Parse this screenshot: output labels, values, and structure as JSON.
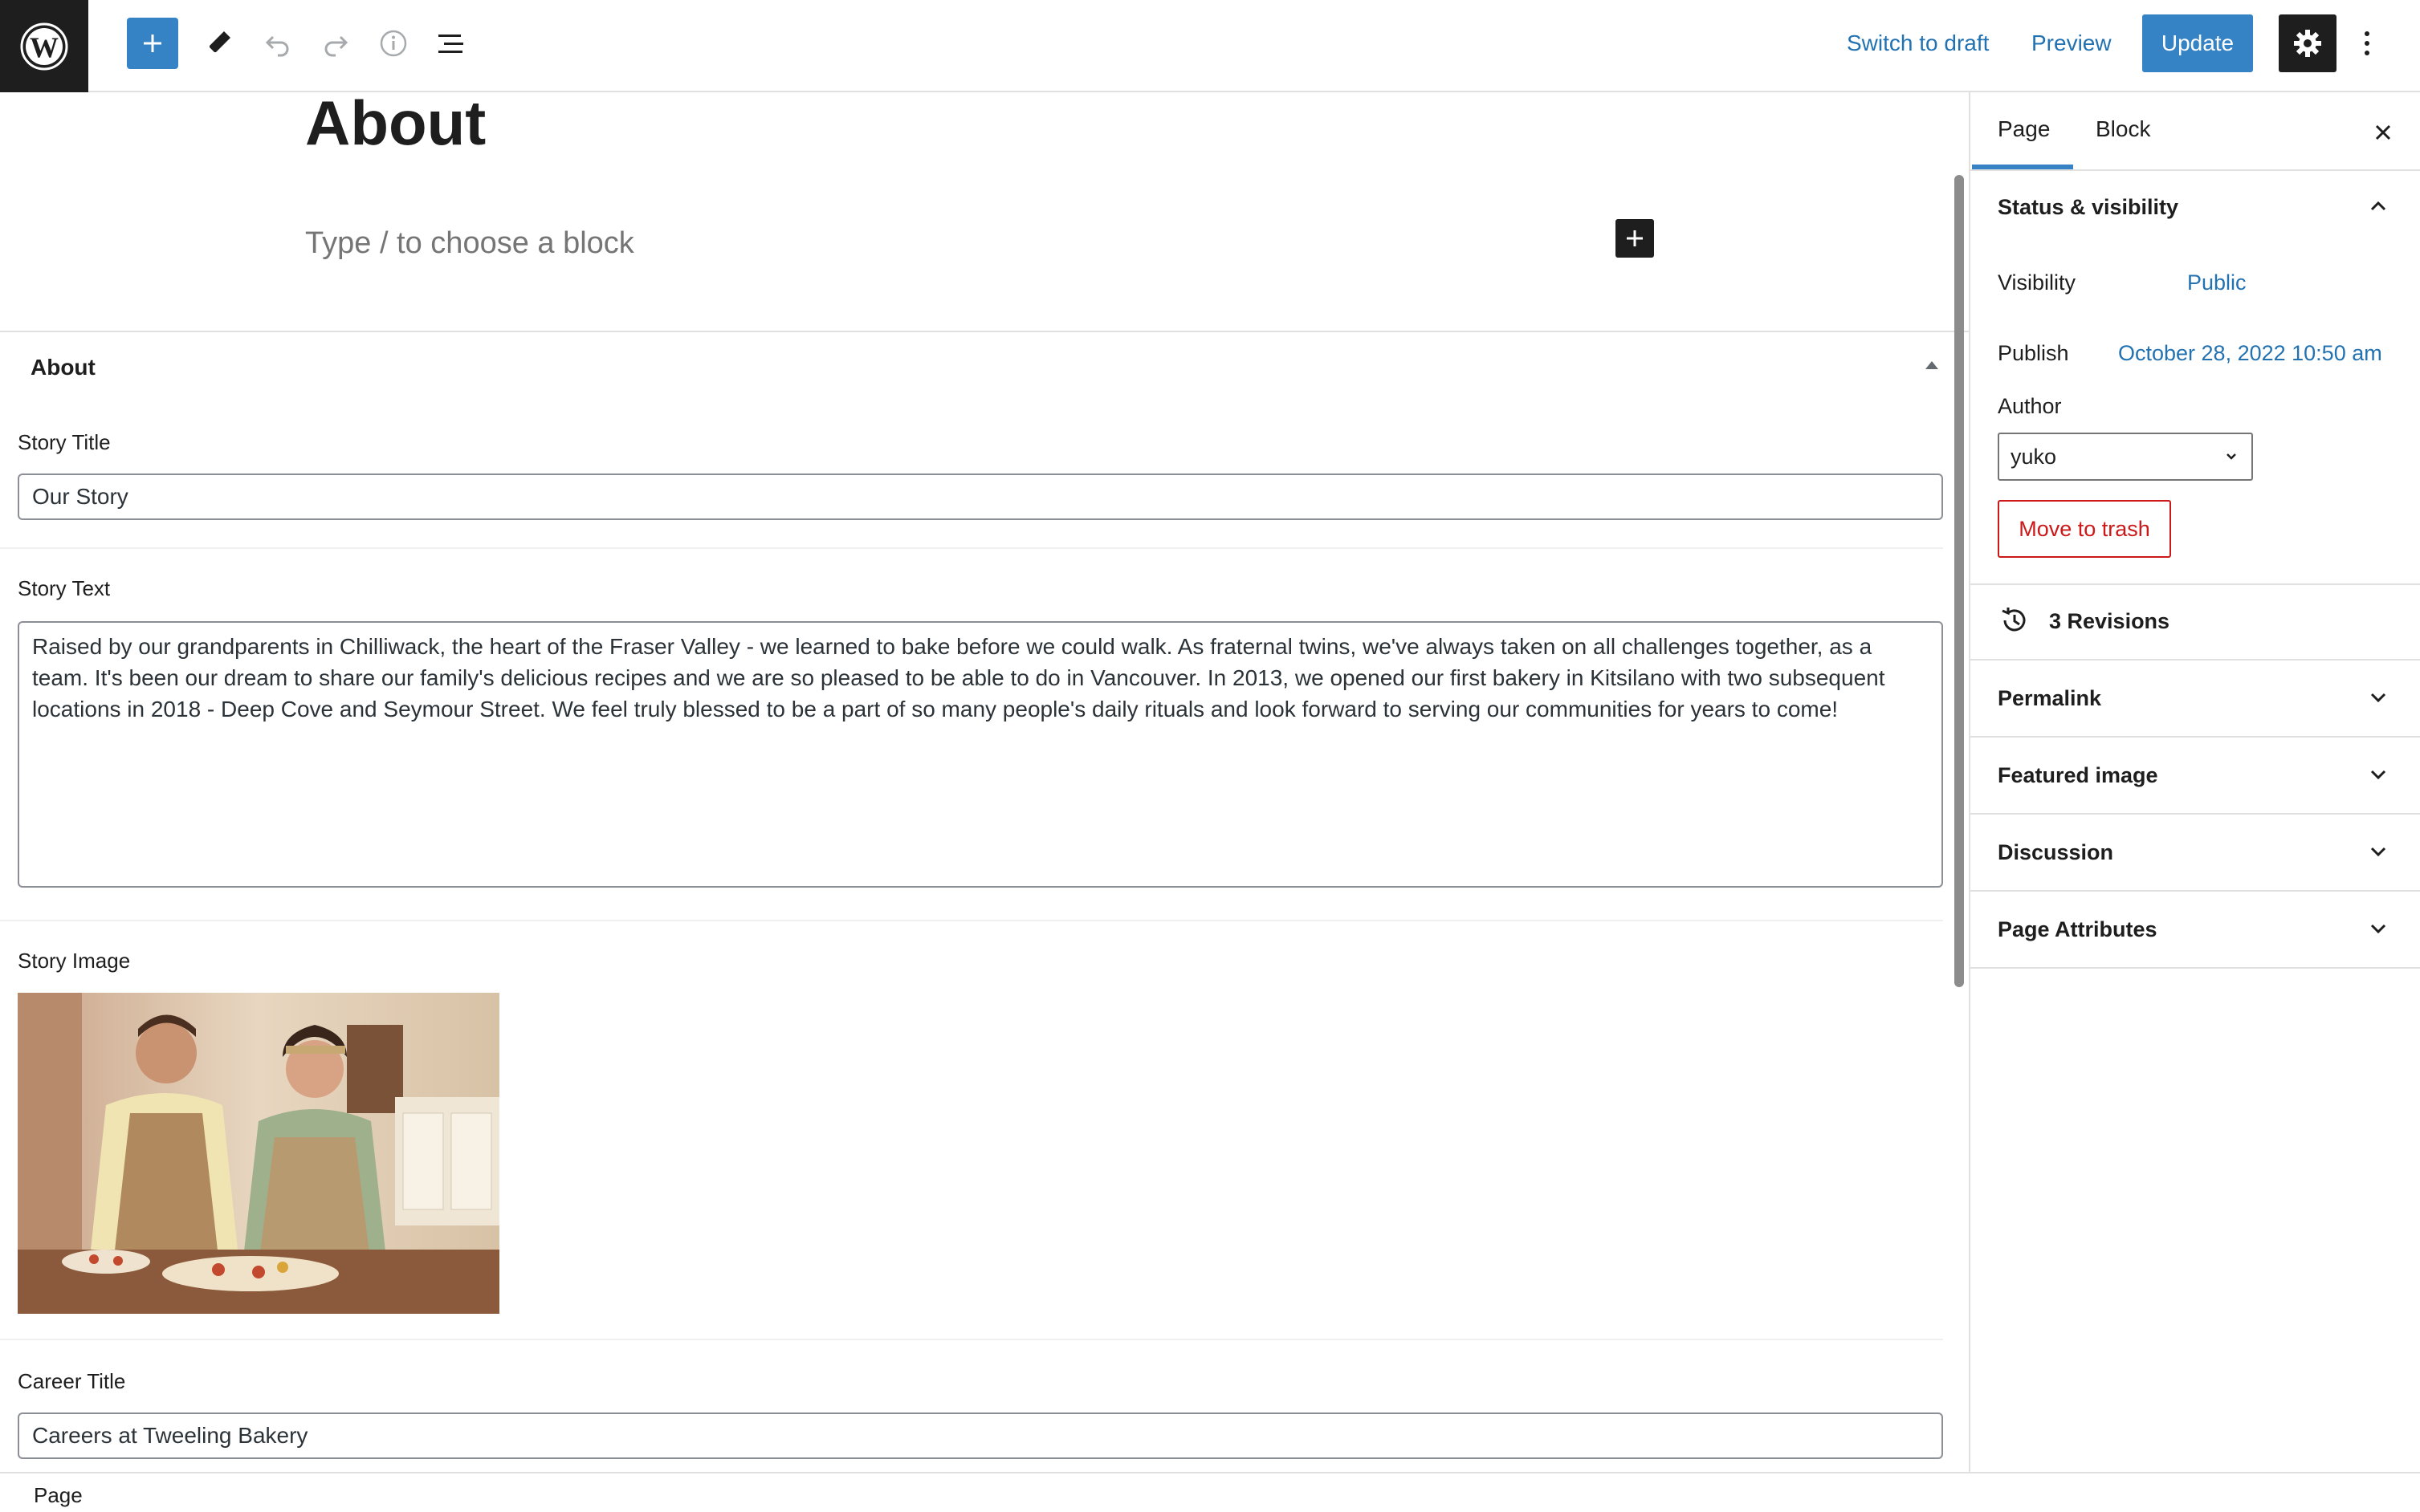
{
  "toolbar": {
    "logo_icon": "wordpress-logo-icon",
    "inserter_icon": "plus-icon",
    "tools_icon": "pencil-icon",
    "undo_icon": "undo-icon",
    "redo_icon": "redo-icon",
    "details_icon": "info-icon",
    "list_view_icon": "list-view-icon",
    "switch_to_draft": "Switch to draft",
    "preview": "Preview",
    "update": "Update",
    "settings_icon": "gear-icon",
    "more_icon": "more-vertical-icon",
    "accent_color": "#3582c4"
  },
  "canvas": {
    "title": "About",
    "appender_placeholder": "Type / to choose a block"
  },
  "metabox": {
    "title": "About",
    "story_title_label": "Story Title",
    "story_title_value": "Our Story",
    "story_text_label": "Story Text",
    "story_text_value": "Raised by our grandparents in Chilliwack, the heart of the Fraser Valley - we learned to bake before we could walk.  As fraternal twins, we've always taken on all challenges together, as a team.  It's been our dream to share our family's delicious recipes and we are so pleased to be able to do in Vancouver.  In 2013, we opened our first bakery in Kitsilano with two subsequent locations in 2018 - Deep Cove and Seymour Street.  We feel truly blessed to be a part of so many people's daily rituals and look forward to serving our communities for years to come!",
    "story_image_label": "Story Image",
    "career_title_label": "Career Title",
    "career_title_value": "Careers at Tweeling Bakery"
  },
  "sidebar": {
    "tabs": [
      {
        "label": "Page",
        "active": true
      },
      {
        "label": "Block",
        "active": false
      }
    ],
    "status_visibility": {
      "title": "Status & visibility",
      "visibility_label": "Visibility",
      "visibility_value": "Public",
      "publish_label": "Publish",
      "publish_value": "October 28, 2022 10:50 am",
      "author_label": "Author",
      "author_value": "yuko",
      "trash_label": "Move to trash"
    },
    "revisions": "3 Revisions",
    "panels": [
      {
        "title": "Permalink"
      },
      {
        "title": "Featured image"
      },
      {
        "title": "Discussion"
      },
      {
        "title": "Page Attributes"
      }
    ]
  },
  "footer": {
    "breadcrumb": "Page"
  }
}
